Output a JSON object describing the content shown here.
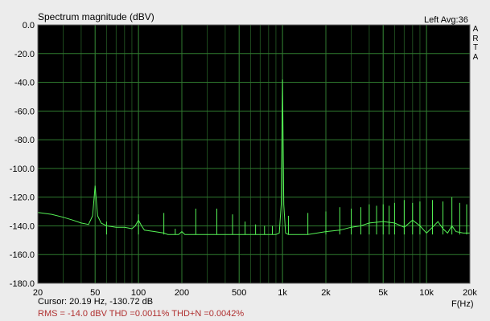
{
  "header": {
    "title": "Spectrum magnitude (dBV)",
    "channel_avg": "Left  Avg:36",
    "brand_letters": [
      "A",
      "R",
      "T",
      "A"
    ]
  },
  "footer": {
    "cursor": "Cursor: 20.19 Hz, -130.72 dB",
    "measurements": "RMS =  -14.0 dBV  THD =0.0011%  THD+N =0.0042%",
    "x_unit": "F(Hz)"
  },
  "colors": {
    "plot_background": "#000000",
    "major_grid": "#2f7a2f",
    "minor_grid": "#1e4a1e",
    "trace": "#55f255",
    "measurement_text": "#b03030"
  },
  "chart_data": {
    "type": "line",
    "title": "Spectrum magnitude (dBV)",
    "xlabel": "F(Hz)",
    "ylabel": "",
    "xscale": "log",
    "xlim": [
      20,
      20000
    ],
    "ylim": [
      -180,
      0
    ],
    "grid": true,
    "y_ticks": [
      "0.0",
      "-20.0",
      "-40.0",
      "-60.0",
      "-80.0",
      "-100.0",
      "-120.0",
      "-140.0",
      "-160.0",
      "-180.0"
    ],
    "y_tick_values": [
      0,
      -20,
      -40,
      -60,
      -80,
      -100,
      -120,
      -140,
      -160,
      -180
    ],
    "x_ticks": [
      "20",
      "50",
      "100",
      "200",
      "500",
      "1k",
      "2k",
      "5k",
      "10k",
      "20k"
    ],
    "x_tick_values": [
      20,
      50,
      100,
      200,
      500,
      1000,
      2000,
      5000,
      10000,
      20000
    ],
    "series": [
      {
        "x": [
          20,
          25,
          30,
          35,
          40,
          45,
          48,
          50,
          52,
          55,
          60,
          70,
          80,
          90,
          95,
          100,
          105,
          110,
          130,
          150,
          160,
          170,
          180,
          190,
          200,
          210,
          250,
          300,
          350,
          400,
          450,
          500,
          600,
          700,
          800,
          900,
          950,
          980,
          1000,
          1020,
          1050,
          1100,
          1200,
          1500,
          2000,
          2500,
          3000,
          3500,
          4000,
          5000,
          6000,
          7000,
          8000,
          9000,
          10000,
          11000,
          12000,
          13000,
          14000,
          15000,
          16000,
          18000,
          20000
        ],
        "y": [
          -130.7,
          -132,
          -134,
          -136,
          -138,
          -139,
          -133,
          -112,
          -133,
          -138,
          -140,
          -141,
          -141,
          -142,
          -140,
          -136,
          -140,
          -143,
          -144,
          -145,
          -146,
          -146,
          -146,
          -146,
          -144,
          -146,
          -146,
          -146,
          -146,
          -146,
          -146,
          -146,
          -146,
          -146,
          -146,
          -146,
          -145,
          -125,
          -38,
          -125,
          -145,
          -146,
          -146,
          -146,
          -144,
          -143,
          -141,
          -140,
          -138,
          -137,
          -138,
          -141,
          -136,
          -140,
          -145,
          -141,
          -137,
          -142,
          -145,
          -140,
          -144,
          -145,
          -145
        ]
      }
    ],
    "harmonic_lines": {
      "x": [
        60,
        100,
        150,
        180,
        250,
        350,
        450,
        550,
        650,
        750,
        850,
        1100,
        1500,
        2000,
        2500,
        3000,
        3500,
        4000,
        4500,
        5000,
        5500,
        6000,
        7000,
        8000,
        9000,
        11000,
        13000,
        15000,
        17000,
        19000
      ],
      "y": [
        -137,
        -132,
        -131,
        -142,
        -128,
        -128,
        -132,
        -137,
        -139,
        -140,
        -140,
        -133,
        -131,
        -130,
        -127,
        -128,
        -127,
        -125,
        -126,
        -125,
        -126,
        -124,
        -122,
        -124,
        -123,
        -122,
        -123,
        -120,
        -124,
        -125
      ]
    }
  }
}
